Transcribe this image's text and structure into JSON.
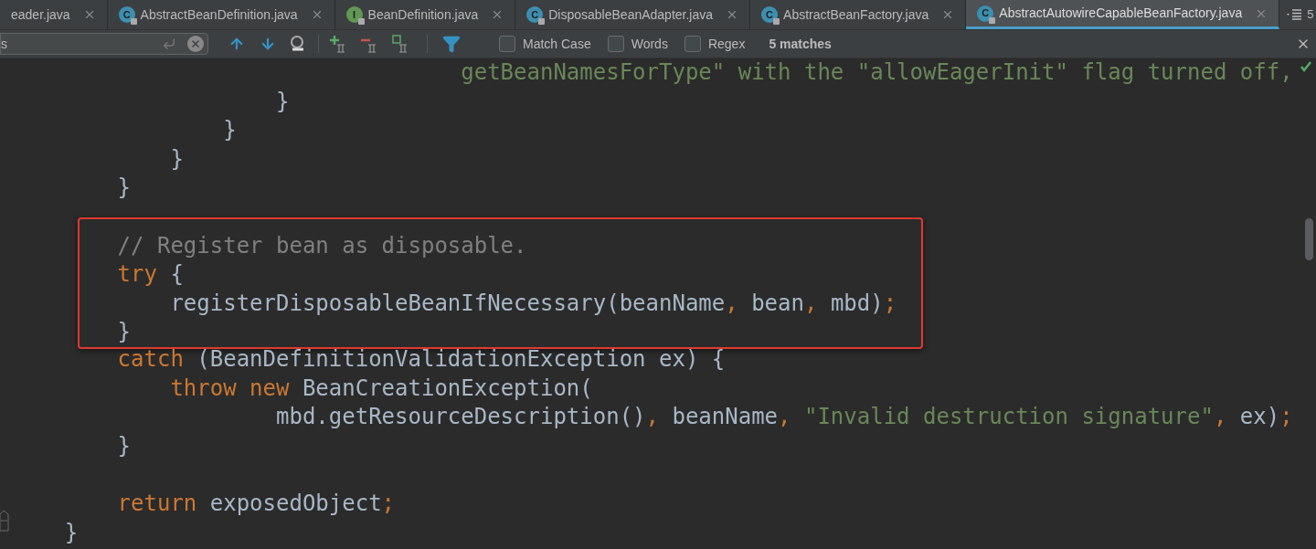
{
  "tabs": [
    {
      "label": "eader.java",
      "kind": "plain",
      "selected": false
    },
    {
      "label": "AbstractBeanDefinition.java",
      "kind": "class",
      "icon_letter": "C",
      "selected": false
    },
    {
      "label": "BeanDefinition.java",
      "kind": "interface",
      "icon_letter": "I",
      "selected": false
    },
    {
      "label": "DisposableBeanAdapter.java",
      "kind": "class",
      "icon_letter": "C",
      "selected": false
    },
    {
      "label": "AbstractBeanFactory.java",
      "kind": "class",
      "icon_letter": "C",
      "selected": false
    },
    {
      "label": "AbstractAutowireCapableBeanFactory.java",
      "kind": "class",
      "icon_letter": "C",
      "selected": true
    }
  ],
  "tab_overflow": {
    "count": "5"
  },
  "search": {
    "value": "s"
  },
  "options": [
    {
      "label": "Match Case",
      "checked": false
    },
    {
      "label": "Words",
      "checked": false
    },
    {
      "label": "Regex",
      "checked": false
    }
  ],
  "match_count": "5 matches",
  "code": [
    {
      "kind": "plain",
      "lines": [
        {
          "kind": "code",
          "tokens": [
            {
              "kind": "string",
              "text": "                                  getBeanNamesForType\" with the \"allowEagerInit\" flag turned off,"
            }
          ]
        },
        {
          "kind": "code",
          "tokens": [
            {
              "kind": "plain",
              "text": "                    }"
            }
          ]
        },
        {
          "kind": "code",
          "tokens": [
            {
              "kind": "plain",
              "text": "                }"
            }
          ]
        },
        {
          "kind": "code",
          "tokens": [
            {
              "kind": "plain",
              "text": "            }"
            }
          ]
        },
        {
          "kind": "code",
          "tokens": [
            {
              "kind": "plain",
              "text": "        }"
            }
          ]
        },
        {
          "kind": "blank"
        }
      ]
    },
    {
      "kind": "highlight",
      "lines": [
        {
          "kind": "code",
          "tokens": [
            {
              "kind": "comment",
              "text": "        // Register bean as disposable."
            }
          ]
        },
        {
          "kind": "code",
          "tokens": [
            {
              "kind": "keyword",
              "text": "        try"
            },
            {
              "kind": "plain",
              "text": " {"
            }
          ]
        },
        {
          "kind": "code",
          "tokens": [
            {
              "kind": "plain",
              "text": "            registerDisposableBeanIfNecessary(beanName"
            },
            {
              "kind": "punct",
              "text": ", "
            },
            {
              "kind": "plain",
              "text": "bean"
            },
            {
              "kind": "punct",
              "text": ", "
            },
            {
              "kind": "plain",
              "text": "mbd)"
            },
            {
              "kind": "punct",
              "text": ";"
            }
          ]
        },
        {
          "kind": "code",
          "tokens": [
            {
              "kind": "plain",
              "text": "        }"
            }
          ]
        }
      ]
    },
    {
      "kind": "plain",
      "lines": [
        {
          "kind": "code",
          "tokens": [
            {
              "kind": "keyword",
              "text": "        catch"
            },
            {
              "kind": "plain",
              "text": " (BeanDefinitionValidationException ex) {"
            }
          ]
        },
        {
          "kind": "code",
          "tokens": [
            {
              "kind": "keyword",
              "text": "            throw new"
            },
            {
              "kind": "plain",
              "text": " BeanCreationException("
            }
          ]
        },
        {
          "kind": "code",
          "tokens": [
            {
              "kind": "plain",
              "text": "                    mbd.getResourceDescription()"
            },
            {
              "kind": "punct",
              "text": ", "
            },
            {
              "kind": "plain",
              "text": "beanName"
            },
            {
              "kind": "punct",
              "text": ", "
            },
            {
              "kind": "string",
              "text": "\"Invalid destruction signature\""
            },
            {
              "kind": "punct",
              "text": ", "
            },
            {
              "kind": "plain",
              "text": "ex)"
            },
            {
              "kind": "punct",
              "text": ";"
            }
          ]
        },
        {
          "kind": "code",
          "tokens": [
            {
              "kind": "plain",
              "text": "        }"
            }
          ]
        },
        {
          "kind": "blank"
        },
        {
          "kind": "code",
          "tokens": [
            {
              "kind": "keyword",
              "text": "        return"
            },
            {
              "kind": "plain",
              "text": " exposedObject"
            },
            {
              "kind": "punct",
              "text": ";"
            }
          ]
        },
        {
          "kind": "code",
          "tokens": [
            {
              "kind": "plain",
              "text": "    }"
            }
          ]
        }
      ]
    }
  ]
}
